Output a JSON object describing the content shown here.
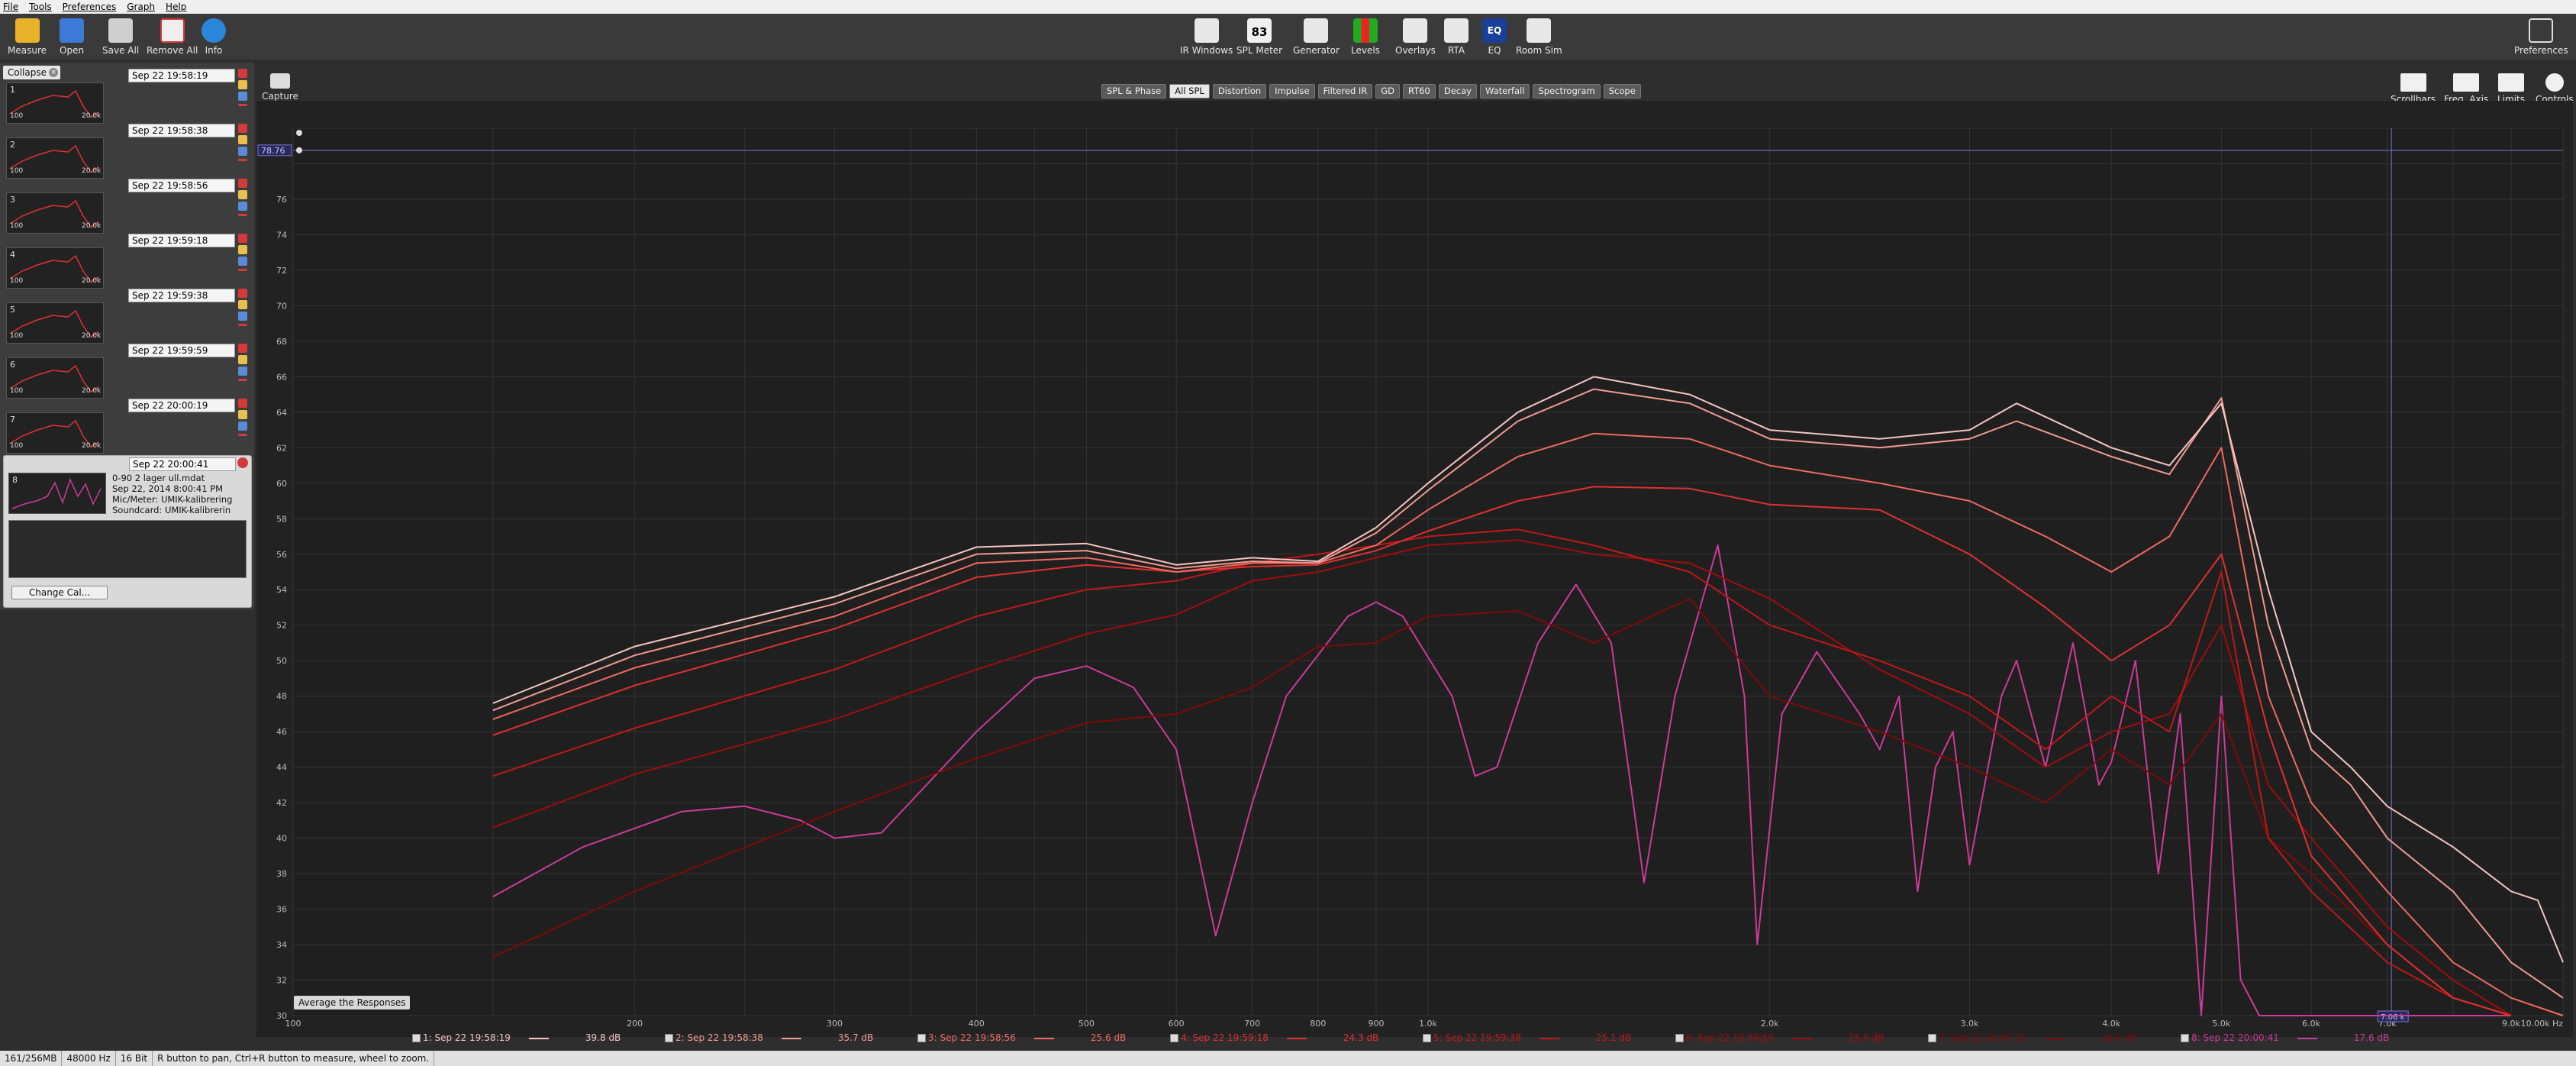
{
  "menu": [
    "File",
    "Tools",
    "Preferences",
    "Graph",
    "Help"
  ],
  "toolbar_left": [
    {
      "label": "Measure",
      "icon": "measure-icon",
      "color": "#e8b22a"
    },
    {
      "label": "Open",
      "icon": "open-folder-icon",
      "color": "#3d7ad8"
    },
    {
      "label": "Save All",
      "icon": "save-all-icon",
      "color": "#cfcfcf"
    },
    {
      "label": "Remove All",
      "icon": "remove-all-icon",
      "color": "#d43a3a"
    },
    {
      "label": "Info",
      "icon": "info-icon",
      "color": "#2a86d8"
    }
  ],
  "toolbar_center": [
    {
      "label": "IR Windows",
      "icon": "ir-windows-icon"
    },
    {
      "label": "SPL Meter",
      "icon": "spl-meter-icon",
      "value": "83"
    },
    {
      "label": "Generator",
      "icon": "generator-icon"
    },
    {
      "label": "Levels",
      "icon": "levels-icon"
    },
    {
      "label": "Overlays",
      "icon": "overlays-icon"
    },
    {
      "label": "RTA",
      "icon": "rta-icon"
    },
    {
      "label": "EQ",
      "icon": "eq-icon"
    },
    {
      "label": "Room Sim",
      "icon": "room-sim-icon"
    }
  ],
  "toolbar_right": {
    "label": "Preferences",
    "icon": "wrench-icon"
  },
  "capture_label": "Capture",
  "tabs": [
    "SPL & Phase",
    "All SPL",
    "Distortion",
    "Impulse",
    "Filtered IR",
    "GD",
    "RT60",
    "Decay",
    "Waterfall",
    "Spectrogram",
    "Scope"
  ],
  "active_tab": "All SPL",
  "graph_controls": [
    "Scrollbars",
    "Freq. Axis",
    "Limits",
    "Controls"
  ],
  "collapse_label": "Collapse",
  "measurements": [
    {
      "idx": "1",
      "name": "Sep 22 19:58:19",
      "thumb_max": "20.0k",
      "thumb_min": "100"
    },
    {
      "idx": "2",
      "name": "Sep 22 19:58:38",
      "thumb_max": "20.0k",
      "thumb_min": "100"
    },
    {
      "idx": "3",
      "name": "Sep 22 19:58:56",
      "thumb_max": "20.0k",
      "thumb_min": "100"
    },
    {
      "idx": "4",
      "name": "Sep 22 19:59:18",
      "thumb_max": "20.0k",
      "thumb_min": "100"
    },
    {
      "idx": "5",
      "name": "Sep 22 19:59:38",
      "thumb_max": "20.0k",
      "thumb_min": "100"
    },
    {
      "idx": "6",
      "name": "Sep 22 19:59:59",
      "thumb_max": "20.0k",
      "thumb_min": "100"
    },
    {
      "idx": "7",
      "name": "Sep 22 20:00:19",
      "thumb_max": "20.0k",
      "thumb_min": "100"
    }
  ],
  "selected": {
    "idx": "8",
    "name": "Sep 22 20:00:41",
    "line1": "0-90 2 lager ull.mdat",
    "line2": "Sep 22, 2014 8:00:41 PM",
    "line3": "Mic/Meter: UMIK-kalibrering",
    "line4": "Soundcard: UMIK-kalibrerin",
    "change_cal": "Change Cal..."
  },
  "cursor_readout": "78.76",
  "cursor_freq": "7.06 k",
  "x_ticks": [
    "100",
    "200",
    "300",
    "400",
    "500",
    "600",
    "700",
    "800",
    "900",
    "1.0k",
    "2.0k",
    "3.0k",
    "4.0k",
    "5.0k",
    "6.0k",
    "7.0k",
    "9.0k",
    "10.00k Hz"
  ],
  "y_ticks": [
    "76",
    "74",
    "72",
    "70",
    "68",
    "66",
    "64",
    "62",
    "60",
    "58",
    "56",
    "54",
    "52",
    "50",
    "48",
    "46",
    "44",
    "42",
    "40",
    "38",
    "36",
    "34",
    "32",
    "30"
  ],
  "avg_label": "Average the Responses",
  "legend": [
    {
      "label": "1: Sep 22 19:58:19",
      "value": "39.8 dB",
      "color": "#f4c4c0"
    },
    {
      "label": "2: Sep 22 19:58:38",
      "value": "35.7 dB",
      "color": "#f29a90"
    },
    {
      "label": "3: Sep 22 19:58:56",
      "value": "25.6 dB",
      "color": "#ef6a60"
    },
    {
      "label": "4: Sep 22 19:59:18",
      "value": "24.3 dB",
      "color": "#e03030"
    },
    {
      "label": "5: Sep 22 19:59:38",
      "value": "25.1 dB",
      "color": "#c01818"
    },
    {
      "label": "6: Sep 22 19:59:59",
      "value": "25.0 dB",
      "color": "#a00c0c"
    },
    {
      "label": "7: Sep 22 20:00:19",
      "value": "16.0 dB",
      "color": "#800808"
    },
    {
      "label": "8: Sep 22 20:00:41",
      "value": "17.6 dB",
      "color": "#cc3a9a"
    }
  ],
  "status": [
    "161/256MB",
    "48000 Hz",
    "16 Bit",
    "R button to pan, Ctrl+R button to measure, wheel to zoom."
  ],
  "chart_data": {
    "type": "line",
    "xlabel": "",
    "ylabel": "",
    "xscale": "log",
    "xlim": [
      100,
      10000
    ],
    "ylim": [
      30,
      80
    ],
    "grid": true,
    "series": [
      {
        "name": "1: Sep 22 19:58:19",
        "color": "#f4c4c0",
        "points": [
          [
            150,
            47.6
          ],
          [
            200,
            50.8
          ],
          [
            300,
            53.6
          ],
          [
            400,
            56.4
          ],
          [
            500,
            56.6
          ],
          [
            600,
            55.4
          ],
          [
            700,
            55.8
          ],
          [
            800,
            55.6
          ],
          [
            900,
            57.5
          ],
          [
            1000,
            60
          ],
          [
            1200,
            64
          ],
          [
            1400,
            66
          ],
          [
            1700,
            65
          ],
          [
            2000,
            63
          ],
          [
            2500,
            62.5
          ],
          [
            3000,
            63
          ],
          [
            3300,
            64.5
          ],
          [
            4000,
            62
          ],
          [
            4500,
            61
          ],
          [
            5000,
            64.5
          ],
          [
            5500,
            54
          ],
          [
            6000,
            46
          ],
          [
            6500,
            44
          ],
          [
            7000,
            41.8
          ],
          [
            8000,
            39.5
          ],
          [
            9000,
            37
          ],
          [
            9500,
            36.5
          ],
          [
            10000,
            33
          ]
        ]
      },
      {
        "name": "2: Sep 22 19:58:38",
        "color": "#f29a90",
        "points": [
          [
            150,
            47.2
          ],
          [
            200,
            50.3
          ],
          [
            300,
            53.2
          ],
          [
            400,
            56
          ],
          [
            500,
            56.2
          ],
          [
            600,
            55.2
          ],
          [
            700,
            55.6
          ],
          [
            800,
            55.5
          ],
          [
            900,
            57.2
          ],
          [
            1000,
            59.6
          ],
          [
            1200,
            63.5
          ],
          [
            1400,
            65.3
          ],
          [
            1700,
            64.5
          ],
          [
            2000,
            62.5
          ],
          [
            2500,
            62
          ],
          [
            3000,
            62.5
          ],
          [
            3300,
            63.5
          ],
          [
            4000,
            61.5
          ],
          [
            4500,
            60.5
          ],
          [
            5000,
            64.8
          ],
          [
            5500,
            52
          ],
          [
            6000,
            45
          ],
          [
            6500,
            43
          ],
          [
            7000,
            40
          ],
          [
            8000,
            37
          ],
          [
            9000,
            33
          ],
          [
            10000,
            31
          ]
        ]
      },
      {
        "name": "3: Sep 22 19:58:56",
        "color": "#ef6a60",
        "points": [
          [
            150,
            46.7
          ],
          [
            200,
            49.6
          ],
          [
            300,
            52.5
          ],
          [
            400,
            55.5
          ],
          [
            500,
            55.8
          ],
          [
            600,
            55
          ],
          [
            700,
            55.5
          ],
          [
            800,
            55.5
          ],
          [
            900,
            56.5
          ],
          [
            1000,
            58.5
          ],
          [
            1200,
            61.5
          ],
          [
            1400,
            62.8
          ],
          [
            1700,
            62.5
          ],
          [
            2000,
            61
          ],
          [
            2500,
            60
          ],
          [
            3000,
            59
          ],
          [
            3500,
            57
          ],
          [
            4000,
            55
          ],
          [
            4500,
            57
          ],
          [
            5000,
            62
          ],
          [
            5500,
            48
          ],
          [
            6000,
            42
          ],
          [
            7000,
            37
          ],
          [
            8000,
            33
          ],
          [
            9000,
            31
          ],
          [
            10000,
            30
          ]
        ]
      },
      {
        "name": "4: Sep 22 19:59:18",
        "color": "#e03030",
        "points": [
          [
            150,
            45.8
          ],
          [
            200,
            48.6
          ],
          [
            300,
            51.8
          ],
          [
            400,
            54.7
          ],
          [
            500,
            55.4
          ],
          [
            600,
            55
          ],
          [
            700,
            55.3
          ],
          [
            800,
            55.4
          ],
          [
            900,
            56.2
          ],
          [
            1000,
            57.3
          ],
          [
            1200,
            59
          ],
          [
            1400,
            59.8
          ],
          [
            1700,
            59.7
          ],
          [
            2000,
            58.8
          ],
          [
            2500,
            58.5
          ],
          [
            3000,
            56
          ],
          [
            3500,
            53
          ],
          [
            4000,
            50
          ],
          [
            4500,
            52
          ],
          [
            5000,
            56
          ],
          [
            5500,
            46
          ],
          [
            6000,
            39
          ],
          [
            7000,
            34
          ],
          [
            8000,
            31
          ],
          [
            9000,
            30
          ]
        ]
      },
      {
        "name": "5: Sep 22 19:59:38",
        "color": "#c01818",
        "points": [
          [
            150,
            43.5
          ],
          [
            200,
            46.2
          ],
          [
            300,
            49.5
          ],
          [
            400,
            52.5
          ],
          [
            500,
            54
          ],
          [
            600,
            54.5
          ],
          [
            700,
            55.5
          ],
          [
            800,
            56
          ],
          [
            900,
            56.5
          ],
          [
            1000,
            57
          ],
          [
            1200,
            57.4
          ],
          [
            1400,
            56.5
          ],
          [
            1700,
            55
          ],
          [
            2000,
            52
          ],
          [
            2500,
            50
          ],
          [
            3000,
            48
          ],
          [
            3500,
            45
          ],
          [
            4000,
            48
          ],
          [
            4500,
            46
          ],
          [
            5000,
            55
          ],
          [
            5500,
            40
          ],
          [
            6000,
            37
          ],
          [
            7000,
            33
          ],
          [
            8000,
            31
          ],
          [
            9000,
            30
          ]
        ]
      },
      {
        "name": "6: Sep 22 19:59:59",
        "color": "#a00c0c",
        "points": [
          [
            150,
            40.6
          ],
          [
            200,
            43.6
          ],
          [
            300,
            46.7
          ],
          [
            400,
            49.5
          ],
          [
            500,
            51.5
          ],
          [
            600,
            52.6
          ],
          [
            700,
            54.5
          ],
          [
            800,
            55
          ],
          [
            900,
            55.8
          ],
          [
            1000,
            56.5
          ],
          [
            1200,
            56.8
          ],
          [
            1400,
            56
          ],
          [
            1700,
            55.5
          ],
          [
            2000,
            53.5
          ],
          [
            2500,
            49.5
          ],
          [
            3000,
            47
          ],
          [
            3500,
            44
          ],
          [
            4000,
            46
          ],
          [
            4500,
            47
          ],
          [
            5000,
            52
          ],
          [
            5500,
            43
          ],
          [
            6000,
            40
          ],
          [
            7000,
            35
          ],
          [
            8000,
            32
          ],
          [
            9000,
            30
          ]
        ]
      },
      {
        "name": "7: Sep 22 20:00:19",
        "color": "#800808",
        "points": [
          [
            150,
            33.3
          ],
          [
            200,
            37
          ],
          [
            300,
            41.5
          ],
          [
            400,
            44.5
          ],
          [
            500,
            46.5
          ],
          [
            600,
            47
          ],
          [
            700,
            48.5
          ],
          [
            800,
            50.8
          ],
          [
            900,
            51
          ],
          [
            1000,
            52.5
          ],
          [
            1200,
            52.8
          ],
          [
            1400,
            51
          ],
          [
            1700,
            53.5
          ],
          [
            2000,
            48
          ],
          [
            2500,
            46
          ],
          [
            3000,
            44
          ],
          [
            3500,
            42
          ],
          [
            4000,
            45
          ],
          [
            4500,
            43
          ],
          [
            5000,
            47
          ],
          [
            5500,
            40
          ],
          [
            6000,
            38
          ],
          [
            7000,
            34
          ],
          [
            8000,
            31
          ],
          [
            9000,
            30
          ]
        ]
      },
      {
        "name": "8: Sep 22 20:00:41",
        "color": "#cc3a9a",
        "points": [
          [
            150,
            36.7
          ],
          [
            180,
            39.5
          ],
          [
            220,
            41.5
          ],
          [
            250,
            41.8
          ],
          [
            280,
            41
          ],
          [
            300,
            40
          ],
          [
            330,
            40.3
          ],
          [
            400,
            46
          ],
          [
            450,
            49
          ],
          [
            500,
            49.7
          ],
          [
            550,
            48.5
          ],
          [
            600,
            45
          ],
          [
            650,
            34.5
          ],
          [
            700,
            42
          ],
          [
            750,
            48
          ],
          [
            850,
            52.5
          ],
          [
            900,
            53.3
          ],
          [
            950,
            52.5
          ],
          [
            1050,
            48
          ],
          [
            1100,
            43.5
          ],
          [
            1150,
            44
          ],
          [
            1250,
            51
          ],
          [
            1350,
            54.3
          ],
          [
            1450,
            51
          ],
          [
            1550,
            37.5
          ],
          [
            1650,
            48
          ],
          [
            1800,
            56.5
          ],
          [
            1900,
            48
          ],
          [
            1950,
            34
          ],
          [
            2050,
            47
          ],
          [
            2200,
            50.5
          ],
          [
            2400,
            47
          ],
          [
            2500,
            45
          ],
          [
            2600,
            48
          ],
          [
            2700,
            37
          ],
          [
            2800,
            44
          ],
          [
            2900,
            46
          ],
          [
            3000,
            38.5
          ],
          [
            3200,
            48
          ],
          [
            3300,
            50
          ],
          [
            3500,
            44
          ],
          [
            3700,
            51
          ],
          [
            3900,
            43
          ],
          [
            4000,
            44.3
          ],
          [
            4200,
            50
          ],
          [
            4400,
            38
          ],
          [
            4600,
            47
          ],
          [
            4800,
            30
          ],
          [
            5000,
            48
          ],
          [
            5200,
            32
          ],
          [
            5400,
            30
          ],
          [
            5600,
            30
          ],
          [
            6000,
            30
          ],
          [
            7000,
            30
          ],
          [
            8000,
            30
          ],
          [
            9000,
            30
          ]
        ]
      }
    ]
  }
}
